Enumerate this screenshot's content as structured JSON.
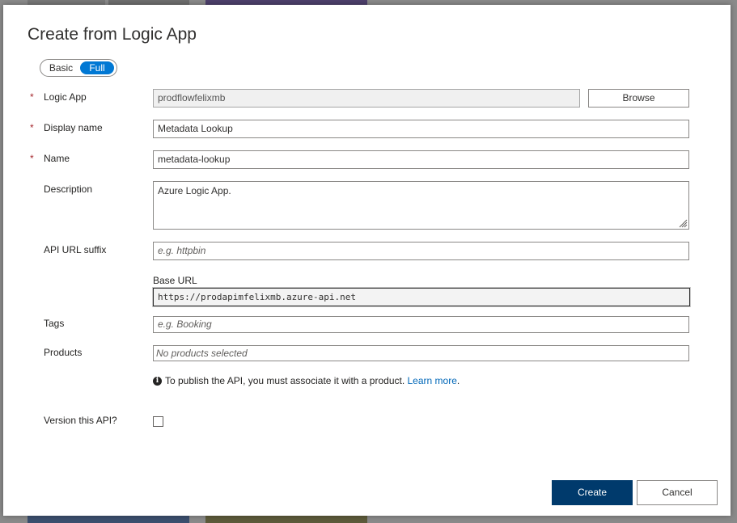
{
  "dialog": {
    "title": "Create from Logic App",
    "mode_toggle": {
      "options": [
        "Basic",
        "Full"
      ],
      "selected": "Full"
    },
    "fields": {
      "logic_app": {
        "label": "Logic App",
        "required": "*",
        "value": "prodflowfelixmb",
        "browse_label": "Browse"
      },
      "display_name": {
        "label": "Display name",
        "required": "*",
        "value": "Metadata Lookup"
      },
      "name": {
        "label": "Name",
        "required": "*",
        "value": "metadata-lookup"
      },
      "description": {
        "label": "Description",
        "value": "Azure Logic App."
      },
      "api_url_suffix": {
        "label": "API URL suffix",
        "placeholder": "e.g. httpbin"
      },
      "base_url": {
        "label": "Base URL",
        "value": "https://prodapimfelixmb.azure-api.net"
      },
      "tags": {
        "label": "Tags",
        "placeholder": "e.g. Booking"
      },
      "products": {
        "label": "Products",
        "placeholder": "No products selected"
      },
      "publish_info": {
        "text": "To publish the API, you must associate it with a product.",
        "link_text": "Learn more",
        "trailing": "."
      },
      "version": {
        "label": "Version this API?",
        "checked": false
      }
    },
    "actions": {
      "create_label": "Create",
      "cancel_label": "Cancel"
    },
    "colors": {
      "primary": "#003a6c",
      "toggle_accent": "#0078d4",
      "required": "#a4262c",
      "link": "#0067b8"
    }
  }
}
